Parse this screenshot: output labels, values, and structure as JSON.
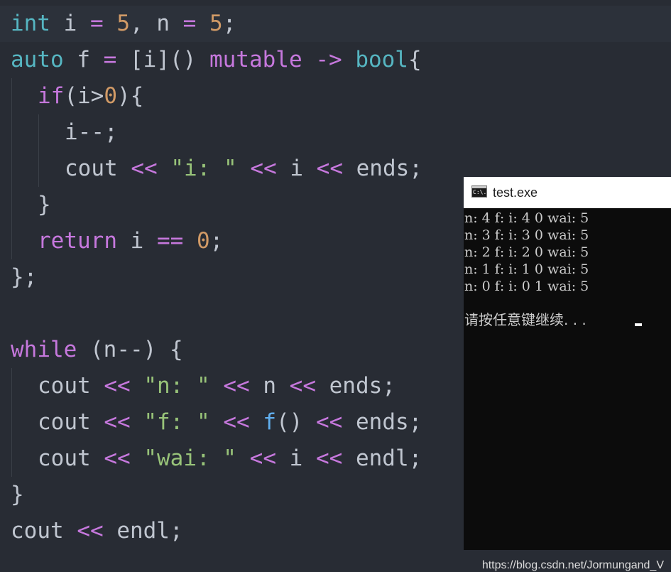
{
  "code": {
    "line1": [
      "int",
      " i ",
      "=",
      " ",
      "5",
      ", n ",
      "=",
      " ",
      "5",
      ";"
    ],
    "line2": [
      "auto",
      " f ",
      "=",
      " [i]() ",
      "mutable",
      " ",
      "->",
      " ",
      "bool",
      "{"
    ],
    "line3": [
      "if",
      "(i>",
      "0",
      "){"
    ],
    "line4": [
      "i--;"
    ],
    "line5": [
      "cout",
      " ",
      "<<",
      " ",
      "\"i: \"",
      " ",
      "<<",
      " i ",
      "<<",
      " ends;"
    ],
    "line6": [
      "}"
    ],
    "line7": [
      "return",
      " i ",
      "==",
      " ",
      "0",
      ";"
    ],
    "line8": [
      "};"
    ],
    "line10": [
      "while",
      " (n--) {"
    ],
    "line11": [
      "cout",
      " ",
      "<<",
      " ",
      "\"n: \"",
      " ",
      "<<",
      " n ",
      "<<",
      " ends;"
    ],
    "line12": [
      "cout",
      " ",
      "<<",
      " ",
      "\"f: \"",
      " ",
      "<<",
      " ",
      "f",
      "() ",
      "<<",
      " ends;"
    ],
    "line13": [
      "cout",
      " ",
      "<<",
      " ",
      "\"wai: \"",
      " ",
      "<<",
      " i ",
      "<<",
      " endl;"
    ],
    "line14": [
      "}"
    ],
    "line15": [
      "cout",
      " ",
      "<<",
      " endl;"
    ]
  },
  "console": {
    "title": "test.exe",
    "icon": "console-app-icon",
    "icon_text": "C:\\.",
    "output_lines": [
      "n: 4 f: i: 4 0 wai: 5",
      "n: 3 f: i: 3 0 wai: 5",
      "n: 2 f: i: 2 0 wai: 5",
      "n: 1 f: i: 1 0 wai: 5",
      "n: 0 f: i: 0 1 wai: 5"
    ],
    "prompt": "请按任意键继续. . . "
  },
  "watermark": "https://blog.csdn.net/Jormungand_V",
  "colors": {
    "background": "#282c34",
    "type": "#56b6c2",
    "keyword": "#c678dd",
    "number": "#d19a66",
    "string": "#98c379",
    "function": "#61afef",
    "identifier": "#c0c6d0",
    "console_bg": "#0c0c0c",
    "console_text": "#cccccc"
  }
}
